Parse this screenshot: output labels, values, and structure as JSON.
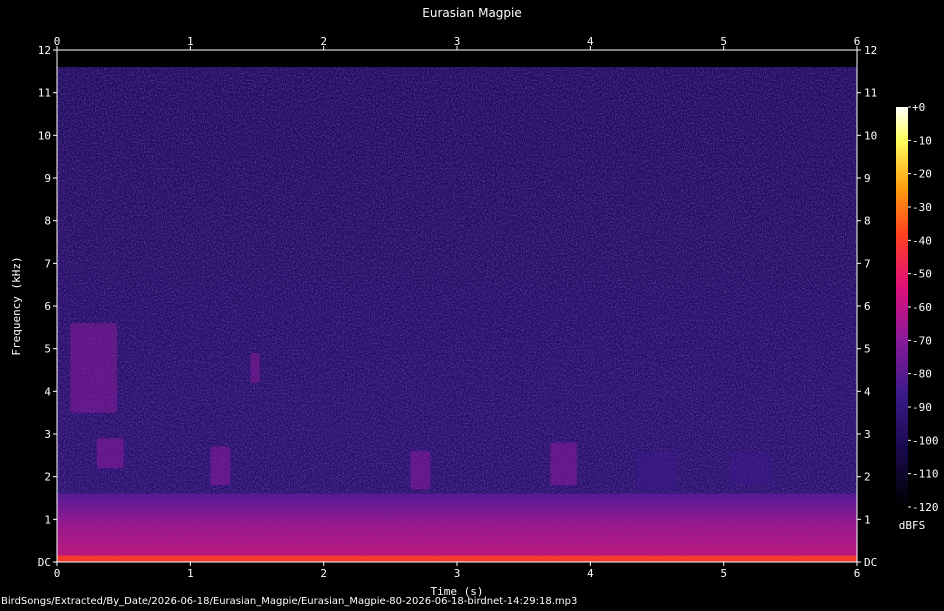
{
  "chart_data": {
    "type": "heatmap",
    "title": "Eurasian Magpie",
    "xlabel": "Time (s)",
    "ylabel": "Frequency (kHz)",
    "xlim": [
      0,
      6
    ],
    "ylim": [
      0,
      12
    ],
    "x_ticks": [
      "0",
      "1",
      "2",
      "3",
      "4",
      "5",
      "6"
    ],
    "y_ticks": [
      "DC",
      "1",
      "2",
      "3",
      "4",
      "5",
      "6",
      "7",
      "8",
      "9",
      "10",
      "11",
      "12"
    ],
    "colorbar": {
      "unit": "dBFS",
      "ticks": [
        "+0",
        "-10",
        "-20",
        "-30",
        "-40",
        "-50",
        "-60",
        "-70",
        "-80",
        "-90",
        "-100",
        "-110",
        "-120"
      ],
      "range": [
        -120,
        0
      ],
      "colormap": [
        "#000000",
        "#1a0a50",
        "#3a1a8a",
        "#8a1a9a",
        "#e0107a",
        "#ff4020",
        "#ffa010",
        "#ffff60",
        "#ffffff"
      ]
    },
    "background_level_db": -100,
    "low_band": {
      "freq_khz": [
        0,
        1.6
      ],
      "level_db": -70,
      "dc_level_db": -50
    },
    "vocalizations": [
      {
        "t": [
          0.1,
          0.45
        ],
        "f": [
          3.5,
          5.6
        ],
        "level_db": -70
      },
      {
        "t": [
          0.3,
          0.5
        ],
        "f": [
          2.2,
          2.9
        ],
        "level_db": -80
      },
      {
        "t": [
          1.15,
          1.3
        ],
        "f": [
          1.8,
          2.7
        ],
        "level_db": -82
      },
      {
        "t": [
          1.45,
          1.52
        ],
        "f": [
          4.2,
          4.9
        ],
        "level_db": -80
      },
      {
        "t": [
          2.65,
          2.8
        ],
        "f": [
          1.7,
          2.6
        ],
        "level_db": -82
      },
      {
        "t": [
          3.7,
          3.9
        ],
        "f": [
          1.8,
          2.8
        ],
        "level_db": -82
      },
      {
        "t": [
          4.35,
          4.65
        ],
        "f": [
          1.7,
          2.6
        ],
        "level_db": -84
      },
      {
        "t": [
          5.05,
          5.35
        ],
        "f": [
          1.8,
          2.6
        ],
        "level_db": -84
      }
    ]
  },
  "footer_path": "BirdSongs/Extracted/By_Date/2026-06-18/Eurasian_Magpie/Eurasian_Magpie-80-2026-06-18-birdnet-14:29:18.mp3"
}
